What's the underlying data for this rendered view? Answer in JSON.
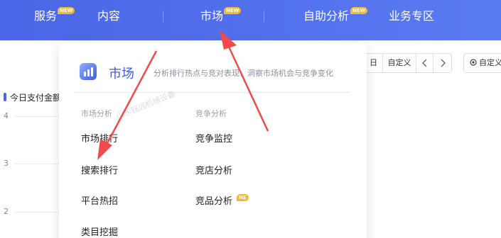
{
  "nav": {
    "items": [
      {
        "label": "服务",
        "badge": "NEW"
      },
      {
        "label": "内容",
        "badge": ""
      },
      {
        "label": "市场",
        "badge": "NEW"
      },
      {
        "label": "自助分析",
        "badge": "NEW"
      },
      {
        "label": "业务专区",
        "badge": ""
      }
    ]
  },
  "background": {
    "legend_label": "今日支付金额",
    "y_ticks": [
      "4",
      "3",
      "2"
    ],
    "toolbar": {
      "day_label": "日",
      "custom_label": "自定义",
      "prev_icon": "chevron-left-icon",
      "next_icon": "chevron-right-icon",
      "custom2_label": "自定义"
    }
  },
  "dropdown": {
    "title": "市场",
    "description": "分析排行热点与竞对表现，洞察市场机会与竞争变化",
    "watermark": "山东铭远机械设备",
    "sections": [
      {
        "heading": "市场分析",
        "items": [
          {
            "label": "市场排行"
          },
          {
            "label": "搜索排行"
          },
          {
            "label": "平台热招"
          },
          {
            "label": "类目挖掘"
          }
        ]
      },
      {
        "heading": "竞争分析",
        "items": [
          {
            "label": "竞争监控"
          },
          {
            "label": "竞店分析"
          },
          {
            "label": "竞品分析",
            "badge": "NE"
          }
        ]
      }
    ]
  },
  "colors": {
    "accent": "#4a66e6",
    "badge": "#f5b82e",
    "annotation_arrow": "#f04a4a"
  }
}
